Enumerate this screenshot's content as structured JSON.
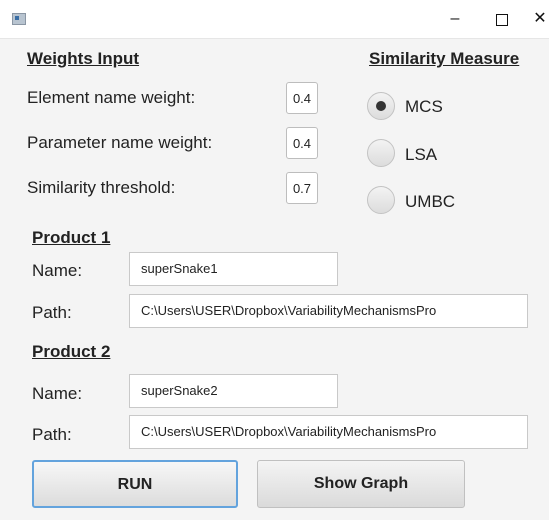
{
  "window": {
    "minimize_glyph": "–",
    "close_glyph": "✕"
  },
  "weights": {
    "heading": "Weights Input",
    "element_label": "Element name weight:",
    "element_value": "0.4",
    "parameter_label": "Parameter name weight:",
    "parameter_value": "0.4",
    "threshold_label": "Similarity threshold:",
    "threshold_value": "0.7"
  },
  "similarity": {
    "heading": "Similarity Measure",
    "options": [
      {
        "label": "MCS",
        "selected": true
      },
      {
        "label": "LSA",
        "selected": false
      },
      {
        "label": "UMBC",
        "selected": false
      }
    ]
  },
  "product1": {
    "heading": "Product 1",
    "name_label": "Name:",
    "name_value": "superSnake1",
    "path_label": "Path:",
    "path_value": "C:\\Users\\USER\\Dropbox\\VariabilityMechanismsPro"
  },
  "product2": {
    "heading": "Product 2",
    "name_label": "Name:",
    "name_value": "superSnake2",
    "path_label": "Path:",
    "path_value": "C:\\Users\\USER\\Dropbox\\VariabilityMechanismsPro"
  },
  "buttons": {
    "run": "RUN",
    "show_graph": "Show Graph"
  },
  "colors": {
    "focus_border": "#63a3dd"
  }
}
